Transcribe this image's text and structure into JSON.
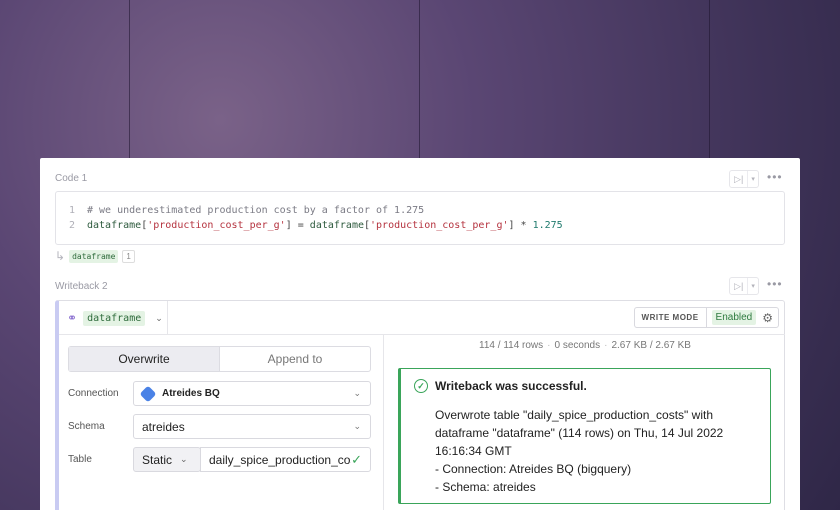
{
  "code_cell": {
    "label": "Code 1",
    "lines": [
      {
        "n": "1",
        "comment": "# we underestimated production cost by a factor of 1.275"
      },
      {
        "n": "2",
        "var1": "dataframe",
        "open1": "[",
        "str1": "'production_cost_per_g'",
        "mid": "] = ",
        "var2": "dataframe",
        "open2": "[",
        "str2": "'production_cost_per_g'",
        "tail": "] * ",
        "num": "1.275"
      }
    ],
    "output_chip": "dataframe",
    "output_count": "1"
  },
  "writeback_cell": {
    "label": "Writeback 2",
    "dataframe": "dataframe",
    "write_mode_label": "WRITE MODE",
    "write_mode_value": "Enabled",
    "tabs": [
      "Overwrite",
      "Append to"
    ],
    "connection": {
      "label": "Connection",
      "value": "Atreides BQ"
    },
    "schema": {
      "label": "Schema",
      "value": "atreides"
    },
    "table": {
      "label": "Table",
      "mode": "Static",
      "value": "daily_spice_production_cos"
    },
    "stats": {
      "rows": "114 / 114 rows",
      "time": "0 seconds",
      "size": "2.67 KB / 2.67 KB"
    },
    "result": {
      "title": "Writeback was successful.",
      "lines": [
        "Overwrote table \"daily_spice_production_costs\" with",
        "dataframe \"dataframe\" (114 rows) on Thu, 14 Jul 2022",
        "16:16:34 GMT",
        "- Connection: Atreides BQ (bigquery)",
        "- Schema: atreides"
      ]
    }
  },
  "icons": [
    "play-icon",
    "chevron-down-icon",
    "more-icon",
    "return-arrow-icon",
    "link-icon",
    "gear-icon",
    "bigquery-icon",
    "check-icon",
    "success-check-icon"
  ],
  "colors": {
    "accent_green": "#3aa55a",
    "writeback_bar": "#c9cbf2",
    "background": "#4b3b63"
  }
}
